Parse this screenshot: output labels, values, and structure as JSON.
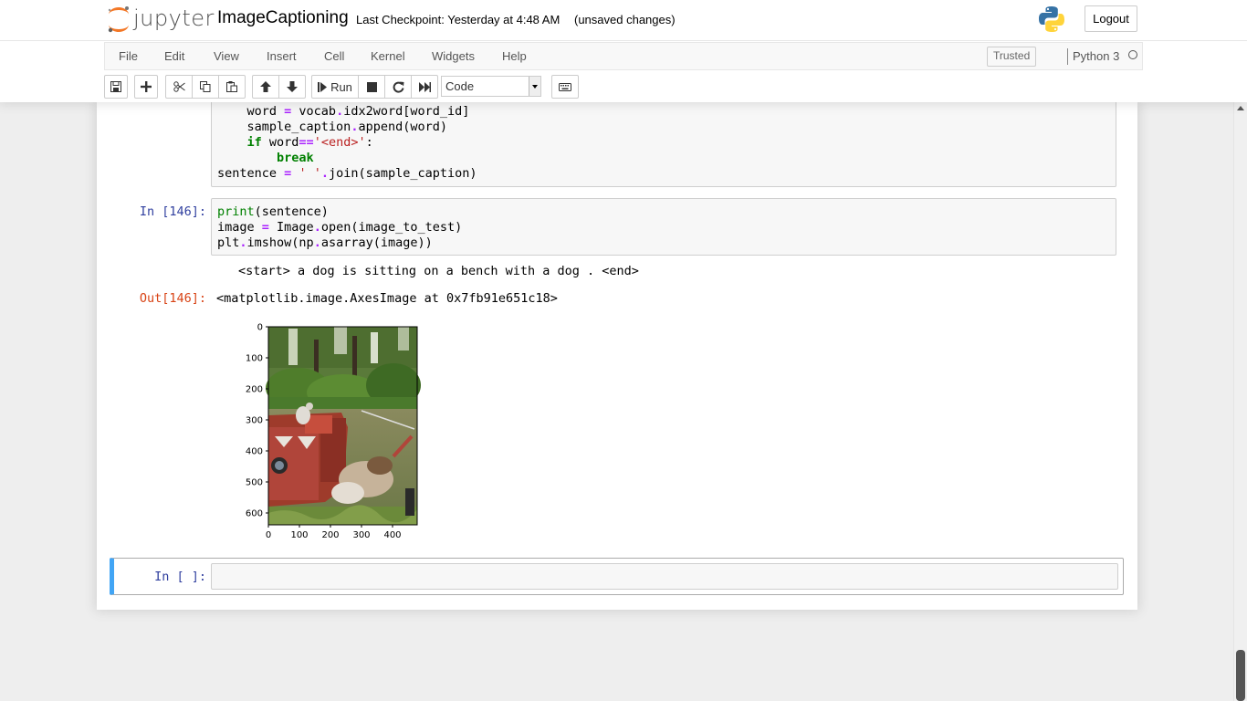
{
  "header": {
    "logo_text": "jupyter",
    "notebook_name": "ImageCaptioning",
    "checkpoint": "Last Checkpoint: Yesterday at 4:48 AM",
    "autosave": "(unsaved changes)",
    "logout_label": "Logout"
  },
  "menubar": {
    "items": [
      "File",
      "Edit",
      "View",
      "Insert",
      "Cell",
      "Kernel",
      "Widgets",
      "Help"
    ],
    "trusted_label": "Trusted",
    "kernel_name": "Python 3"
  },
  "toolbar": {
    "run_label": "Run",
    "cell_type": "Code",
    "icons": [
      "save-icon",
      "plus-icon",
      "cut-icon",
      "copy-icon",
      "paste-icon",
      "arrow-up-icon",
      "arrow-down-icon",
      "step-forward-icon",
      "stop-icon",
      "restart-icon",
      "fast-forward-icon",
      "keyboard-icon"
    ]
  },
  "cells": {
    "cell1": {
      "lines": [
        "    word = vocab.idx2word[word_id]",
        "    sample_caption.append(word)",
        "    if word=='<end>':",
        "        break",
        "sentence = ' '.join(sample_caption)"
      ]
    },
    "cell2": {
      "prompt_in": "In [146]:",
      "lines": [
        "print(sentence)",
        "image = Image.open(image_to_test)",
        "plt.imshow(np.asarray(image))"
      ],
      "stdout": "<start> a dog is sitting on a bench with a dog . <end>",
      "prompt_out": "Out[146]:",
      "result": "<matplotlib.image.AxesImage at 0x7fb91e651c18>"
    },
    "cell3": {
      "prompt_in": "In [ ]:"
    }
  },
  "plot": {
    "y_ticks": [
      "0",
      "100",
      "200",
      "300",
      "400",
      "500",
      "600"
    ],
    "x_ticks": [
      "0",
      "100",
      "200",
      "300",
      "400"
    ]
  },
  "chart_data": {
    "type": "image",
    "x_ticks": [
      0,
      100,
      200,
      300,
      400
    ],
    "y_ticks": [
      0,
      100,
      200,
      300,
      400,
      500,
      600
    ],
    "xlim": [
      0,
      480
    ],
    "ylim": [
      640,
      0
    ]
  }
}
